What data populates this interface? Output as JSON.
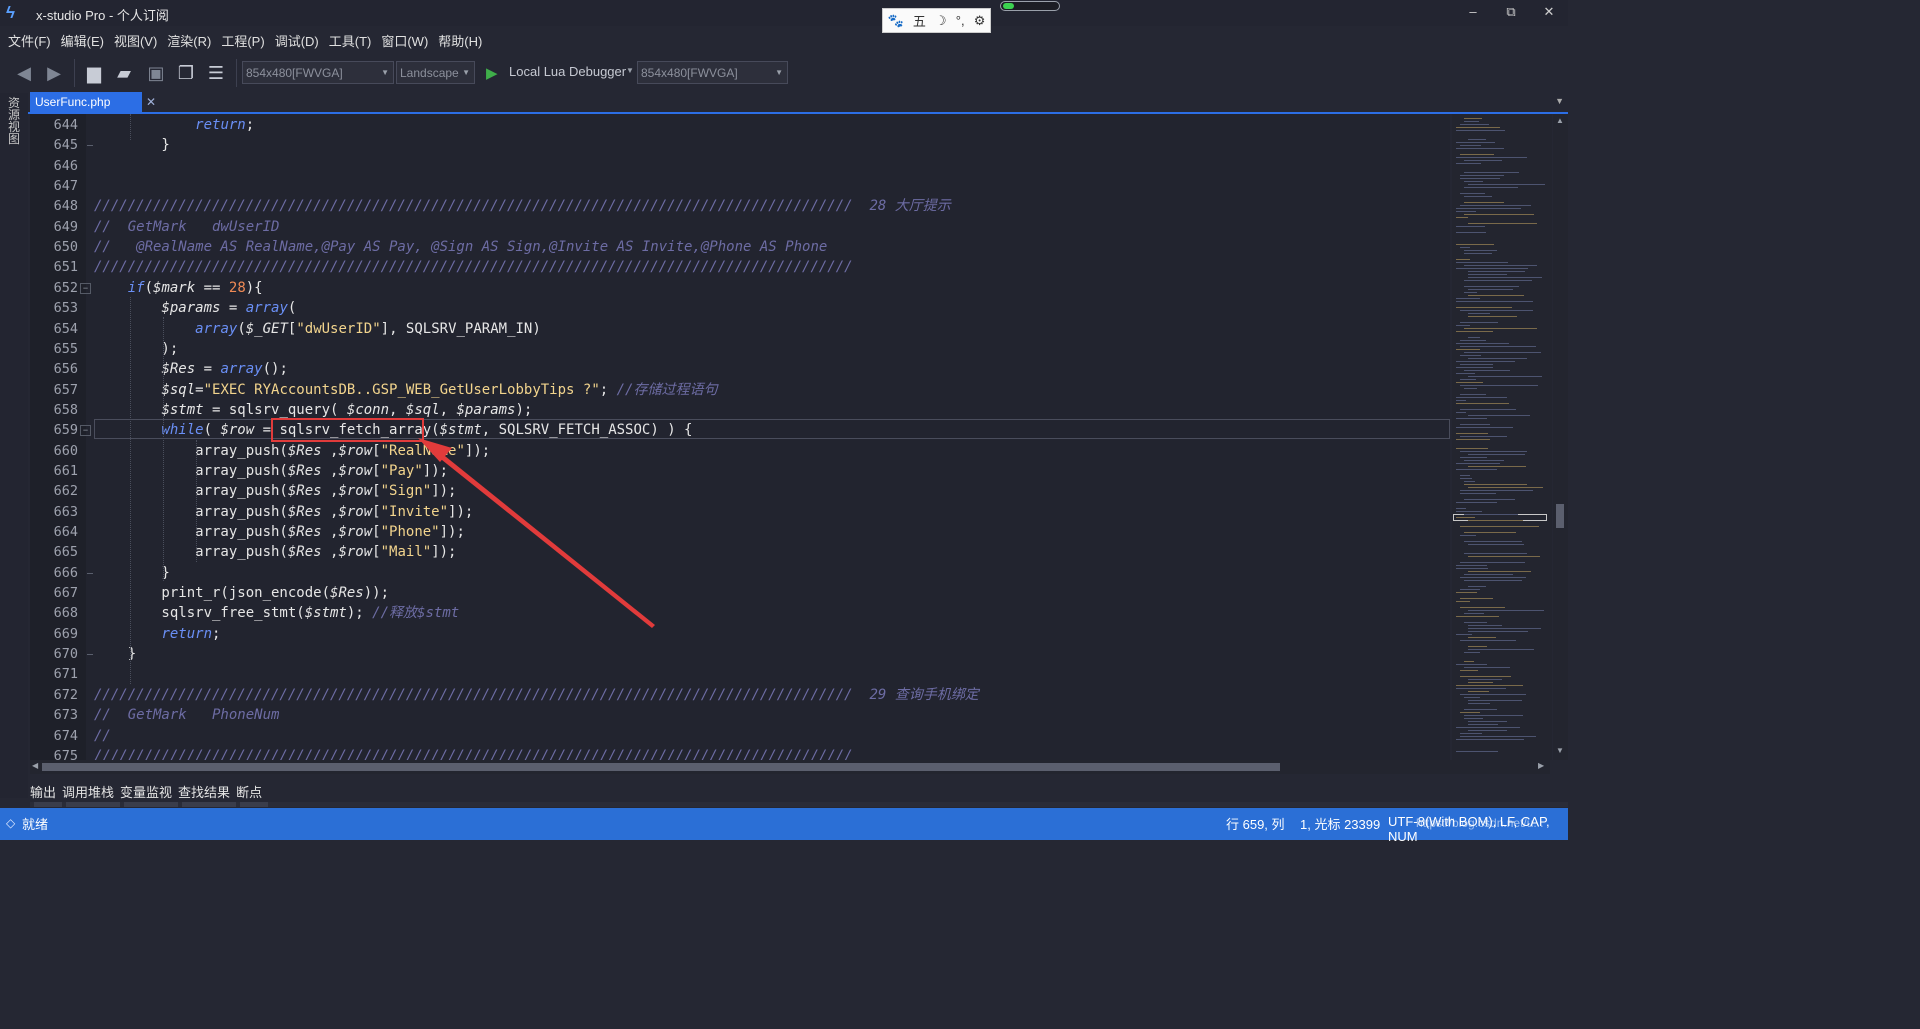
{
  "window": {
    "title": "x-studio Pro - 个人订阅",
    "controls": [
      "–",
      "⧉",
      "✕"
    ],
    "performance_meter_fraction": 0.2
  },
  "ime_toolbar": {
    "items": [
      "🐾",
      "五",
      "☽",
      "°,",
      "⚙"
    ]
  },
  "menu": [
    "文件(F)",
    "编辑(E)",
    "视图(V)",
    "渲染(R)",
    "工程(P)",
    "调试(D)",
    "工具(T)",
    "窗口(W)",
    "帮助(H)"
  ],
  "toolbar": {
    "resolution": "854x480[FWVGA]",
    "orientation": "Landscape",
    "debugger": "Local Lua Debugger",
    "device_resolution": "854x480[FWVGA]"
  },
  "side_panel": {
    "label": "资源视图"
  },
  "tab": {
    "title": "UserFunc.php",
    "close": "✕"
  },
  "code": {
    "current_line": 659,
    "lines": [
      {
        "n": "644",
        "tokens": [
          {
            "t": "            "
          },
          {
            "t": "return",
            "c": "k"
          },
          {
            "t": ";"
          }
        ]
      },
      {
        "n": "645",
        "tokens": [
          {
            "t": "        }"
          }
        ]
      },
      {
        "n": "646",
        "tokens": [
          {
            "t": ""
          }
        ]
      },
      {
        "n": "647",
        "tokens": [
          {
            "t": ""
          }
        ]
      },
      {
        "n": "648",
        "tokens": [
          {
            "t": "//////////////////////////////////////////////////////////////////////////////////////////  28 大厅提示",
            "c": "c"
          }
        ]
      },
      {
        "n": "649",
        "tokens": [
          {
            "t": "//  GetMark   dwUserID",
            "c": "c"
          }
        ]
      },
      {
        "n": "650",
        "tokens": [
          {
            "t": "//   @RealName AS RealName,@Pay AS Pay, @Sign AS Sign,@Invite AS Invite,@Phone AS Phone",
            "c": "c"
          }
        ]
      },
      {
        "n": "651",
        "tokens": [
          {
            "t": "//////////////////////////////////////////////////////////////////////////////////////////",
            "c": "c"
          }
        ]
      },
      {
        "n": "652",
        "tokens": [
          {
            "t": "    "
          },
          {
            "t": "if",
            "c": "k"
          },
          {
            "t": "("
          },
          {
            "t": "$mark",
            "c": "v"
          },
          {
            "t": " == "
          },
          {
            "t": "28",
            "c": "n"
          },
          {
            "t": "){"
          }
        ]
      },
      {
        "n": "653",
        "tokens": [
          {
            "t": "        "
          },
          {
            "t": "$params",
            "c": "v"
          },
          {
            "t": " = "
          },
          {
            "t": "array",
            "c": "k"
          },
          {
            "t": "("
          }
        ]
      },
      {
        "n": "654",
        "tokens": [
          {
            "t": "            "
          },
          {
            "t": "array",
            "c": "k"
          },
          {
            "t": "("
          },
          {
            "t": "$_GET",
            "c": "v"
          },
          {
            "t": "["
          },
          {
            "t": "\"dwUserID\"",
            "c": "s"
          },
          {
            "t": "], SQLSRV_PARAM_IN)"
          }
        ]
      },
      {
        "n": "655",
        "tokens": [
          {
            "t": "        );"
          }
        ]
      },
      {
        "n": "656",
        "tokens": [
          {
            "t": "        "
          },
          {
            "t": "$Res",
            "c": "v"
          },
          {
            "t": " = "
          },
          {
            "t": "array",
            "c": "k"
          },
          {
            "t": "();"
          }
        ]
      },
      {
        "n": "657",
        "tokens": [
          {
            "t": "        "
          },
          {
            "t": "$sql",
            "c": "v"
          },
          {
            "t": "="
          },
          {
            "t": "\"EXEC RYAccountsDB..GSP_WEB_GetUserLobbyTips ?\"",
            "c": "s"
          },
          {
            "t": "; "
          },
          {
            "t": "//存储过程语句",
            "c": "c"
          }
        ]
      },
      {
        "n": "658",
        "tokens": [
          {
            "t": "        "
          },
          {
            "t": "$stmt",
            "c": "v"
          },
          {
            "t": " = sqlsrv_query( "
          },
          {
            "t": "$conn",
            "c": "v"
          },
          {
            "t": ", "
          },
          {
            "t": "$sql",
            "c": "v"
          },
          {
            "t": ", "
          },
          {
            "t": "$params",
            "c": "v"
          },
          {
            "t": ");"
          }
        ]
      },
      {
        "n": "659",
        "tokens": [
          {
            "t": "        "
          },
          {
            "t": "while",
            "c": "k"
          },
          {
            "t": "( "
          },
          {
            "t": "$row",
            "c": "v"
          },
          {
            "t": " = sqlsrv_fetch_array("
          },
          {
            "t": "$stmt",
            "c": "v"
          },
          {
            "t": ", SQLSRV_FETCH_ASSOC) ) {"
          }
        ]
      },
      {
        "n": "660",
        "tokens": [
          {
            "t": "            array_push("
          },
          {
            "t": "$Res",
            "c": "v"
          },
          {
            "t": " ,"
          },
          {
            "t": "$row",
            "c": "v"
          },
          {
            "t": "["
          },
          {
            "t": "\"RealName\"",
            "c": "s"
          },
          {
            "t": "]);"
          }
        ]
      },
      {
        "n": "661",
        "tokens": [
          {
            "t": "            array_push("
          },
          {
            "t": "$Res",
            "c": "v"
          },
          {
            "t": " ,"
          },
          {
            "t": "$row",
            "c": "v"
          },
          {
            "t": "["
          },
          {
            "t": "\"Pay\"",
            "c": "s"
          },
          {
            "t": "]);"
          }
        ]
      },
      {
        "n": "662",
        "tokens": [
          {
            "t": "            array_push("
          },
          {
            "t": "$Res",
            "c": "v"
          },
          {
            "t": " ,"
          },
          {
            "t": "$row",
            "c": "v"
          },
          {
            "t": "["
          },
          {
            "t": "\"Sign\"",
            "c": "s"
          },
          {
            "t": "]);"
          }
        ]
      },
      {
        "n": "663",
        "tokens": [
          {
            "t": "            array_push("
          },
          {
            "t": "$Res",
            "c": "v"
          },
          {
            "t": " ,"
          },
          {
            "t": "$row",
            "c": "v"
          },
          {
            "t": "["
          },
          {
            "t": "\"Invite\"",
            "c": "s"
          },
          {
            "t": "]);"
          }
        ]
      },
      {
        "n": "664",
        "tokens": [
          {
            "t": "            array_push("
          },
          {
            "t": "$Res",
            "c": "v"
          },
          {
            "t": " ,"
          },
          {
            "t": "$row",
            "c": "v"
          },
          {
            "t": "["
          },
          {
            "t": "\"Phone\"",
            "c": "s"
          },
          {
            "t": "]);"
          }
        ]
      },
      {
        "n": "665",
        "tokens": [
          {
            "t": "            array_push("
          },
          {
            "t": "$Res",
            "c": "v"
          },
          {
            "t": " ,"
          },
          {
            "t": "$row",
            "c": "v"
          },
          {
            "t": "["
          },
          {
            "t": "\"Mail\"",
            "c": "s"
          },
          {
            "t": "]);"
          }
        ]
      },
      {
        "n": "666",
        "tokens": [
          {
            "t": "        }"
          }
        ]
      },
      {
        "n": "667",
        "tokens": [
          {
            "t": "        print_r(json_encode("
          },
          {
            "t": "$Res",
            "c": "v"
          },
          {
            "t": "));"
          }
        ]
      },
      {
        "n": "668",
        "tokens": [
          {
            "t": "        sqlsrv_free_stmt("
          },
          {
            "t": "$stmt",
            "c": "v"
          },
          {
            "t": "); "
          },
          {
            "t": "//释放$stmt",
            "c": "c"
          }
        ]
      },
      {
        "n": "669",
        "tokens": [
          {
            "t": "        "
          },
          {
            "t": "return",
            "c": "k"
          },
          {
            "t": ";"
          }
        ]
      },
      {
        "n": "670",
        "tokens": [
          {
            "t": "    }"
          }
        ]
      },
      {
        "n": "671",
        "tokens": [
          {
            "t": ""
          }
        ]
      },
      {
        "n": "672",
        "tokens": [
          {
            "t": "//////////////////////////////////////////////////////////////////////////////////////////  29 查询手机绑定",
            "c": "c"
          }
        ]
      },
      {
        "n": "673",
        "tokens": [
          {
            "t": "//  GetMark   PhoneNum",
            "c": "c"
          }
        ]
      },
      {
        "n": "674",
        "tokens": [
          {
            "t": "//",
            "c": "c"
          }
        ]
      },
      {
        "n": "675",
        "tokens": [
          {
            "t": "//////////////////////////////////////////////////////////////////////////////////////////",
            "c": "c"
          }
        ]
      }
    ]
  },
  "bottom_tabs": [
    "输出",
    "调用堆栈",
    "变量监视",
    "查找结果",
    "断点"
  ],
  "status": {
    "ready": "就绪",
    "position": "行 659, 列",
    "cursor": "1, 光标 23399",
    "encoding": "UTF-8(With BOM), LF, CAP, NUM",
    "watermark": "https://blog.csdn.net/u..."
  },
  "colors": {
    "accent": "#2c6ee5",
    "keyword": "#6a8ff5",
    "string": "#f2d48d",
    "number": "#ef8a55",
    "comment": "#6d6ca4",
    "annotation": "#e13b3b"
  }
}
